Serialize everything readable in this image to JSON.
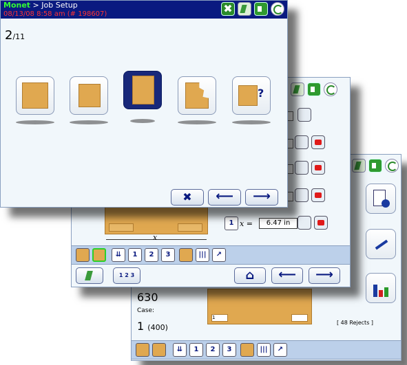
{
  "front": {
    "brand": "Monet",
    "title": " > Job Setup",
    "status": "08/13/08  8:58 am  (# 198607)",
    "page_current": "2",
    "page_total": "/11",
    "options": [
      {
        "name": "full-pallet-option"
      },
      {
        "name": "stringer-pallet-option"
      },
      {
        "name": "block-pallet-option"
      },
      {
        "name": "damaged-pallet-option"
      },
      {
        "name": "unknown-pallet-option",
        "glyph": "?"
      }
    ],
    "cancel_glyph": "✖",
    "back_glyph": "⟵",
    "next_glyph": "⟶"
  },
  "middle": {
    "x_label": "x",
    "x_eq": "x =",
    "x_value": "6.47 in",
    "step_glyphs": [
      "1",
      "2",
      "3"
    ],
    "multi_glyph": "1 2 3",
    "home_glyph": "⌂"
  },
  "back": {
    "count": "630",
    "case_label": "Case:",
    "case_count": "1",
    "case_total": "(400)",
    "rejects": "[ 48 Rejects ]"
  }
}
